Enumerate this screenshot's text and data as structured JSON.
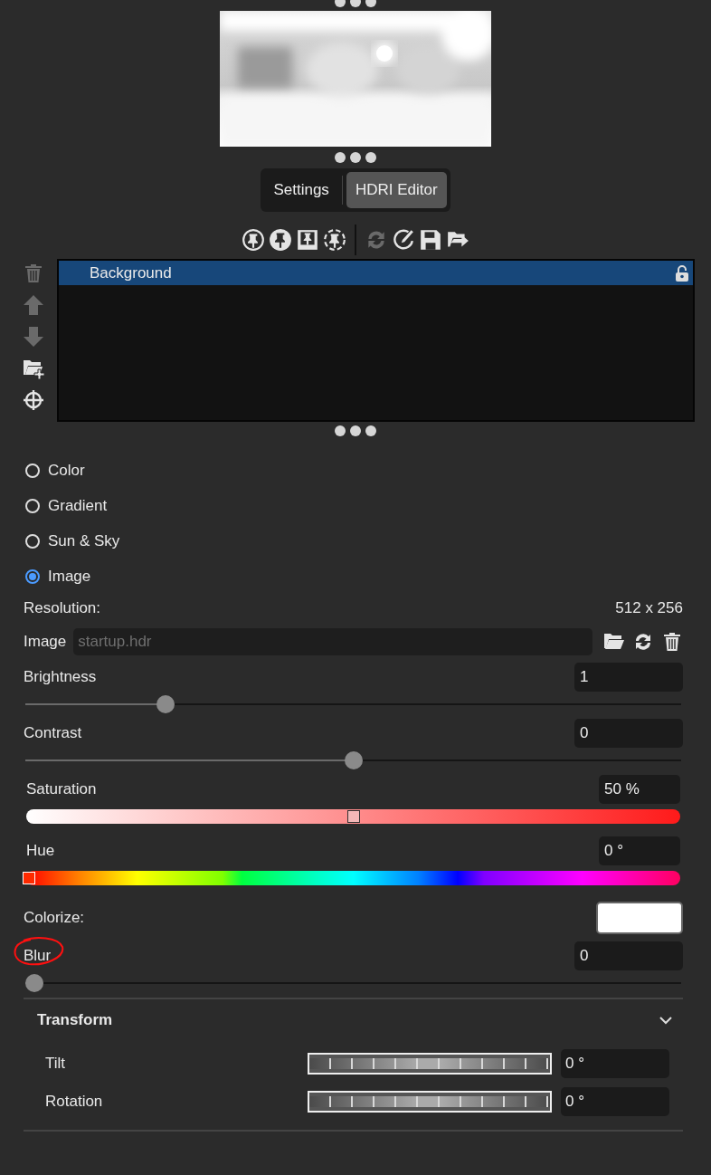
{
  "preview": {
    "kind": "picture"
  },
  "tabs": [
    {
      "label": "Settings",
      "selected": false
    },
    {
      "label": "HDRI Editor",
      "selected": true
    }
  ],
  "toolbar": [
    [
      {
        "kind": "pin",
        "disabled": false
      },
      {
        "kind": "pushpin",
        "disabled": false
      },
      {
        "kind": "board",
        "disabled": false
      },
      {
        "kind": "dashed",
        "disabled": false
      }
    ],
    [
      {
        "kind": "refresh",
        "disabled": true
      },
      {
        "kind": "brush",
        "disabled": false
      },
      {
        "kind": "save",
        "disabled": false
      },
      {
        "kind": "export",
        "disabled": false
      }
    ]
  ],
  "layer_tools": [
    {
      "kind": "trash",
      "disabled": true
    },
    {
      "kind": "up",
      "disabled": true
    },
    {
      "kind": "down",
      "disabled": true
    },
    {
      "kind": "folderadd",
      "disabled": false
    },
    {
      "kind": "target",
      "disabled": false
    }
  ],
  "layers": [
    {
      "name": "Background",
      "selected": true,
      "locked": false
    }
  ],
  "sources": [
    {
      "label": "Color",
      "selected": false
    },
    {
      "label": "Gradient",
      "selected": false
    },
    {
      "label": "Sun & Sky",
      "selected": false
    },
    {
      "label": "Image",
      "selected": true
    }
  ],
  "resolution": {
    "label": "Resolution:",
    "value": "512 x 256"
  },
  "image_file": {
    "label": "Image",
    "placeholder": "startup.hdr"
  },
  "controls": [
    {
      "kind": "plain",
      "label": "Brightness",
      "value": "1",
      "level": 0.205,
      "circled": false
    },
    {
      "kind": "plain",
      "label": "Contrast",
      "value": "0",
      "level": 0.5,
      "circled": false
    },
    {
      "kind": "saturation",
      "label": "Saturation",
      "value": "50 %",
      "level": 0.5,
      "circled": false
    },
    {
      "kind": "hue",
      "label": "Hue",
      "value": "0 °",
      "level": 0,
      "circled": false
    },
    {
      "kind": "color",
      "label": "Colorize:",
      "color": "#ffffff",
      "circled": false
    },
    {
      "kind": "plain",
      "label": "Blur",
      "value": "0",
      "level": 0,
      "circled": true
    }
  ],
  "transform": {
    "title": "Transform",
    "expanded": true,
    "rows": [
      {
        "label": "Tilt",
        "value": "0 °"
      },
      {
        "label": "Rotation",
        "value": "0 °"
      }
    ]
  }
}
